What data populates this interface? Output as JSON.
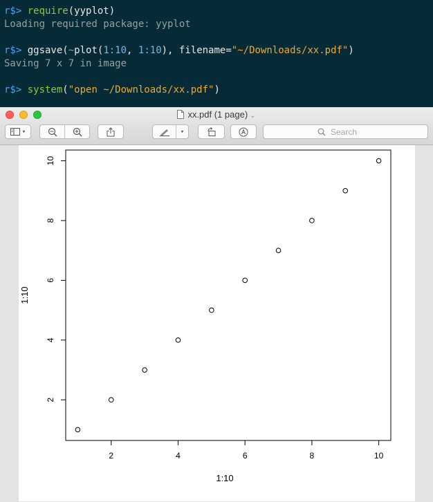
{
  "terminal": {
    "lines": [
      {
        "prompt": "r$> ",
        "fn": "require",
        "rest": "(yyplot)"
      },
      {
        "output": "Loading required package: yyplot"
      },
      {
        "prompt": "r$> ",
        "fn": "ggsave",
        "p1": "(",
        "tilde": "~",
        "call": "plot(",
        "n1": "1:10",
        "comma": ", ",
        "n2": "1:10",
        "close": "), filename=",
        "str": "\"~/Downloads/xx.pdf\"",
        "end": ")"
      },
      {
        "output": "Saving 7 x 7 in image"
      },
      {
        "prompt": "r$> ",
        "fn": "system",
        "p1": "(",
        "str": "\"open ~/Downloads/xx.pdf\"",
        "end": ")"
      }
    ]
  },
  "window": {
    "title": "xx.pdf (1 page)",
    "search_placeholder": "Search",
    "toolbar": {
      "sidebar_icon": "sidebar-icon",
      "zoom_out_icon": "zoom-out-icon",
      "zoom_in_icon": "zoom-in-icon",
      "share_icon": "share-icon",
      "markup_icon": "pen-icon",
      "rotate_icon": "rotate-icon",
      "annotate_icon": "annotate-icon"
    }
  },
  "chart_data": {
    "type": "scatter",
    "x": [
      1,
      2,
      3,
      4,
      5,
      6,
      7,
      8,
      9,
      10
    ],
    "y": [
      1,
      2,
      3,
      4,
      5,
      6,
      7,
      8,
      9,
      10
    ],
    "xlabel": "1:10",
    "ylabel": "1:10",
    "xticks": [
      2,
      4,
      6,
      8,
      10
    ],
    "yticks": [
      2,
      4,
      6,
      8,
      10
    ],
    "xlim": [
      0.64,
      10.36
    ],
    "ylim": [
      0.64,
      10.36
    ],
    "grid": false,
    "marker": "open-circle"
  }
}
